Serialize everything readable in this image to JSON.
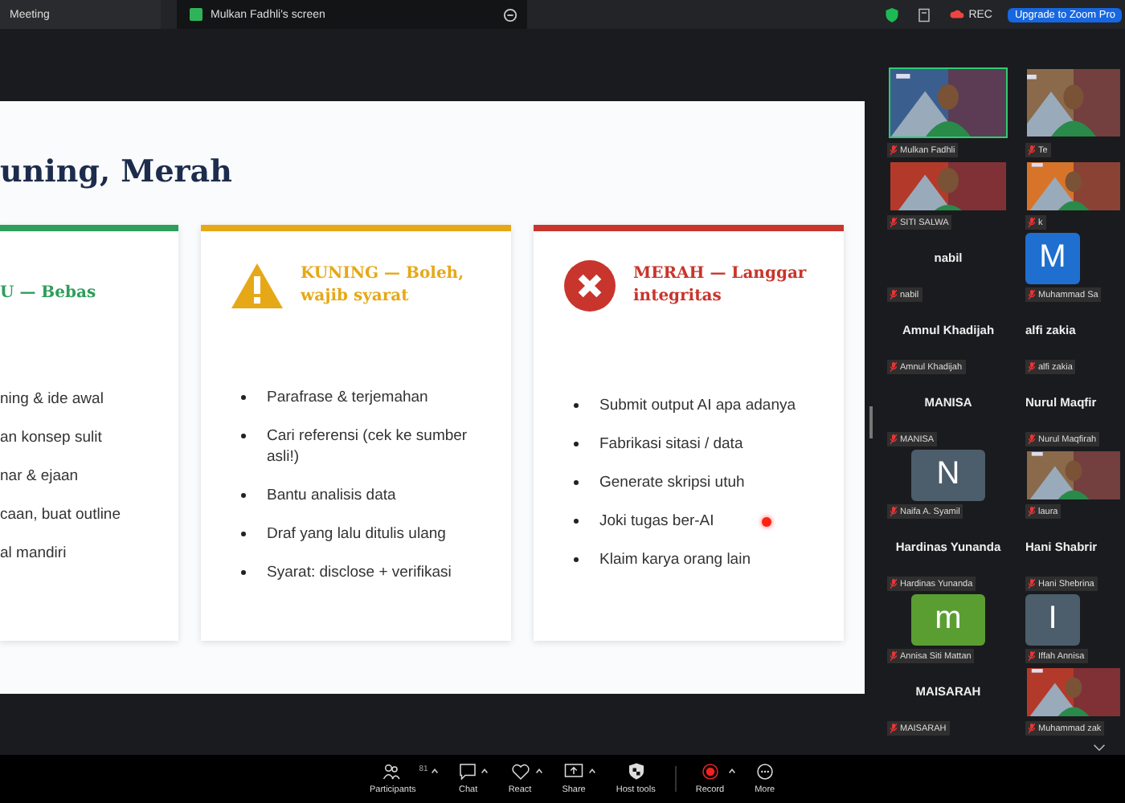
{
  "top_bar": {
    "tabs": [
      {
        "label": "Meeting",
        "selected": false
      },
      {
        "label": "Mulkan Fadhli's screen",
        "selected": true
      }
    ],
    "rec_label": "REC",
    "upgrade_button": "Upgrade to Zoom Pro"
  },
  "slide": {
    "title": "uning, Merah",
    "cards": [
      {
        "kind": "none",
        "heading": "U — Bebas",
        "color": "#2e9e5b",
        "items": [
          "ning & ide awal",
          "an konsep sulit",
          "nar & ejaan",
          "caan, buat outline",
          "al mandiri"
        ]
      },
      {
        "kind": "warning",
        "heading": "KUNING — Boleh, wajib syarat",
        "color": "#e6a817",
        "items": [
          "Parafrase & terjemahan",
          "Cari referensi (cek ke sumber asli!)",
          "Bantu analisis data",
          "Draf yang lalu ditulis ulang",
          "Syarat: disclose + verifikasi"
        ]
      },
      {
        "kind": "error",
        "heading": "MERAH — Langgar integritas",
        "color": "#c8352c",
        "items": [
          "Submit output AI apa adanya",
          "Fabrikasi sitasi / data",
          "Generate skripsi utuh",
          "Joki tugas ber-AI",
          "Klaim karya orang lain"
        ]
      }
    ]
  },
  "participants": [
    {
      "kind": "video",
      "label": "Mulkan Fadhli",
      "speaking": true
    },
    {
      "kind": "video",
      "label": "Te",
      "speaking": false
    },
    {
      "kind": "video",
      "label": "SITI SALWA",
      "speaking": false
    },
    {
      "kind": "video",
      "label": "k",
      "speaking": false
    },
    {
      "kind": "name",
      "name": "nabil",
      "label": "nabil"
    },
    {
      "kind": "avatar",
      "initial": "M",
      "color": "#1f6fd1",
      "label": "Muhammad Sa"
    },
    {
      "kind": "name",
      "name": "Amnul Khadijah",
      "label": "Amnul Khadijah"
    },
    {
      "kind": "name",
      "name": "alfi zakia",
      "label": "alfi zakia"
    },
    {
      "kind": "name",
      "name": "MANISA",
      "label": "MANISA"
    },
    {
      "kind": "name",
      "name": "Nurul Maqfir",
      "label": "Nurul Maqfirah"
    },
    {
      "kind": "avatar",
      "initial": "N",
      "color": "#4c5d6b",
      "label": "Naifa A. Syamil"
    },
    {
      "kind": "video",
      "label": "laura",
      "speaking": false
    },
    {
      "kind": "name",
      "name": "Hardinas Yunanda",
      "label": "Hardinas Yunanda"
    },
    {
      "kind": "name",
      "name": "Hani Shabrir",
      "label": "Hani Shebrina"
    },
    {
      "kind": "avatar",
      "initial": "m",
      "color": "#5a9e32",
      "label": "Annisa Siti Mattan"
    },
    {
      "kind": "avatar",
      "initial": "I",
      "color": "#4c5d6b",
      "label": "Iffah Annisa"
    },
    {
      "kind": "name",
      "name": "MAISARAH",
      "label": "MAISARAH"
    },
    {
      "kind": "video",
      "label": "Muhammad zak",
      "speaking": false
    }
  ],
  "toolbar": [
    {
      "label": "Participants",
      "count": "81",
      "caret": true
    },
    {
      "label": "Chat",
      "caret": true
    },
    {
      "label": "React",
      "caret": true
    },
    {
      "label": "Share",
      "caret": true
    },
    {
      "label": "Host tools",
      "caret": false
    },
    {
      "label": "Record",
      "caret": true
    },
    {
      "label": "More",
      "caret": false
    }
  ]
}
